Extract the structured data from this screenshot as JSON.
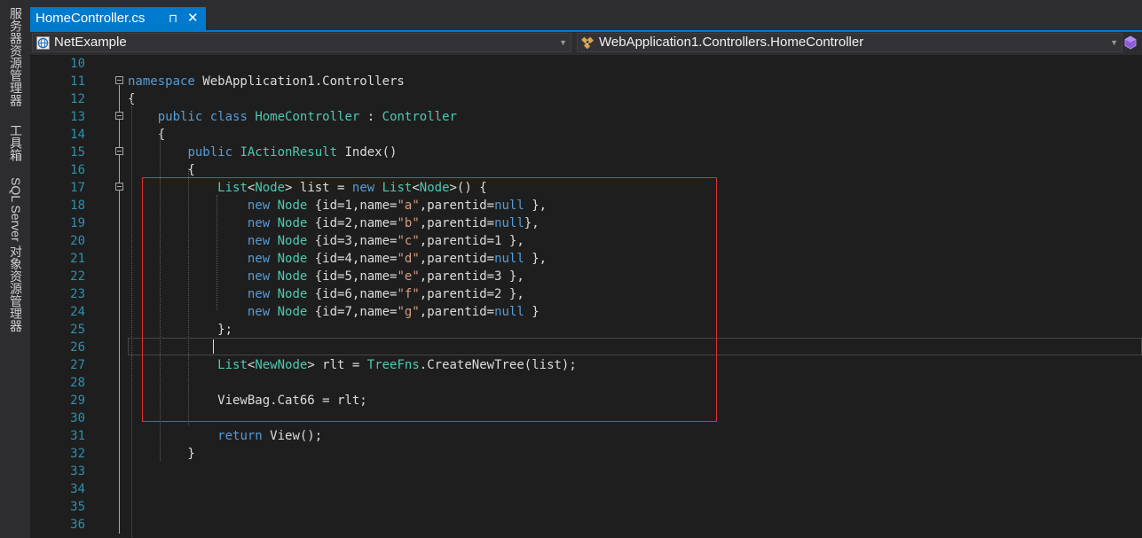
{
  "side_panels": [
    "服务器资源管理器",
    "工具箱",
    "SQL Server 对象资源管理器"
  ],
  "tab": {
    "title": "HomeController.cs",
    "pin_glyph": "⊓",
    "close_glyph": "✕"
  },
  "nav": {
    "project": "NetExample",
    "class": "WebApplication1.Controllers.HomeController"
  },
  "code": {
    "line_numbers": [
      "10",
      "11",
      "12",
      "13",
      "14",
      "15",
      "16",
      "17",
      "18",
      "19",
      "20",
      "21",
      "22",
      "23",
      "24",
      "25",
      "26",
      "27",
      "28",
      "29",
      "30",
      "31",
      "32",
      "33",
      "34",
      "35",
      "36"
    ],
    "lines": [
      [],
      [
        {
          "t": "namespace",
          "c": "kw"
        },
        {
          "t": " WebApplication1.Controllers"
        }
      ],
      [
        {
          "t": "{"
        }
      ],
      [
        {
          "t": "    "
        },
        {
          "t": "public",
          "c": "kw"
        },
        {
          "t": " "
        },
        {
          "t": "class",
          "c": "kw"
        },
        {
          "t": " "
        },
        {
          "t": "HomeController",
          "c": "ty"
        },
        {
          "t": " : "
        },
        {
          "t": "Controller",
          "c": "ty"
        }
      ],
      [
        {
          "t": "    {"
        }
      ],
      [
        {
          "t": "        "
        },
        {
          "t": "public",
          "c": "kw"
        },
        {
          "t": " "
        },
        {
          "t": "IActionResult",
          "c": "ty"
        },
        {
          "t": " Index()"
        }
      ],
      [
        {
          "t": "        {"
        }
      ],
      [
        {
          "t": "            "
        },
        {
          "t": "List",
          "c": "ty"
        },
        {
          "t": "<"
        },
        {
          "t": "Node",
          "c": "ty"
        },
        {
          "t": "> list = "
        },
        {
          "t": "new",
          "c": "kw"
        },
        {
          "t": " "
        },
        {
          "t": "List",
          "c": "ty"
        },
        {
          "t": "<"
        },
        {
          "t": "Node",
          "c": "ty"
        },
        {
          "t": ">() {"
        }
      ],
      [
        {
          "t": "                "
        },
        {
          "t": "new",
          "c": "kw"
        },
        {
          "t": " "
        },
        {
          "t": "Node",
          "c": "ty"
        },
        {
          "t": " {id=1,name="
        },
        {
          "t": "\"a\"",
          "c": "str"
        },
        {
          "t": ",parentid="
        },
        {
          "t": "null",
          "c": "kw"
        },
        {
          "t": " },"
        }
      ],
      [
        {
          "t": "                "
        },
        {
          "t": "new",
          "c": "kw"
        },
        {
          "t": " "
        },
        {
          "t": "Node",
          "c": "ty"
        },
        {
          "t": " {id=2,name="
        },
        {
          "t": "\"b\"",
          "c": "str"
        },
        {
          "t": ",parentid="
        },
        {
          "t": "null",
          "c": "kw"
        },
        {
          "t": "},"
        }
      ],
      [
        {
          "t": "                "
        },
        {
          "t": "new",
          "c": "kw"
        },
        {
          "t": " "
        },
        {
          "t": "Node",
          "c": "ty"
        },
        {
          "t": " {id=3,name="
        },
        {
          "t": "\"c\"",
          "c": "str"
        },
        {
          "t": ",parentid=1 },"
        }
      ],
      [
        {
          "t": "                "
        },
        {
          "t": "new",
          "c": "kw"
        },
        {
          "t": " "
        },
        {
          "t": "Node",
          "c": "ty"
        },
        {
          "t": " {id=4,name="
        },
        {
          "t": "\"d\"",
          "c": "str"
        },
        {
          "t": ",parentid="
        },
        {
          "t": "null",
          "c": "kw"
        },
        {
          "t": " },"
        }
      ],
      [
        {
          "t": "                "
        },
        {
          "t": "new",
          "c": "kw"
        },
        {
          "t": " "
        },
        {
          "t": "Node",
          "c": "ty"
        },
        {
          "t": " {id=5,name="
        },
        {
          "t": "\"e\"",
          "c": "str"
        },
        {
          "t": ",parentid=3 },"
        }
      ],
      [
        {
          "t": "                "
        },
        {
          "t": "new",
          "c": "kw"
        },
        {
          "t": " "
        },
        {
          "t": "Node",
          "c": "ty"
        },
        {
          "t": " {id=6,name="
        },
        {
          "t": "\"f\"",
          "c": "str"
        },
        {
          "t": ",parentid=2 },"
        }
      ],
      [
        {
          "t": "                "
        },
        {
          "t": "new",
          "c": "kw"
        },
        {
          "t": " "
        },
        {
          "t": "Node",
          "c": "ty"
        },
        {
          "t": " {id=7,name="
        },
        {
          "t": "\"g\"",
          "c": "str"
        },
        {
          "t": ",parentid="
        },
        {
          "t": "null",
          "c": "kw"
        },
        {
          "t": " }"
        }
      ],
      [
        {
          "t": "            };"
        }
      ],
      [],
      [
        {
          "t": "            "
        },
        {
          "t": "List",
          "c": "ty"
        },
        {
          "t": "<"
        },
        {
          "t": "NewNode",
          "c": "ty"
        },
        {
          "t": "> rlt = "
        },
        {
          "t": "TreeFns",
          "c": "ty"
        },
        {
          "t": ".CreateNewTree(list);"
        }
      ],
      [],
      [
        {
          "t": "            ViewBag.Cat66 = rlt;"
        }
      ],
      [],
      [
        {
          "t": "            "
        },
        {
          "t": "return",
          "c": "kw"
        },
        {
          "t": " View();"
        }
      ],
      [
        {
          "t": "        }"
        }
      ],
      [],
      [],
      [],
      []
    ]
  },
  "colors": {
    "accent": "#007acc",
    "annotation": "#e03131"
  }
}
